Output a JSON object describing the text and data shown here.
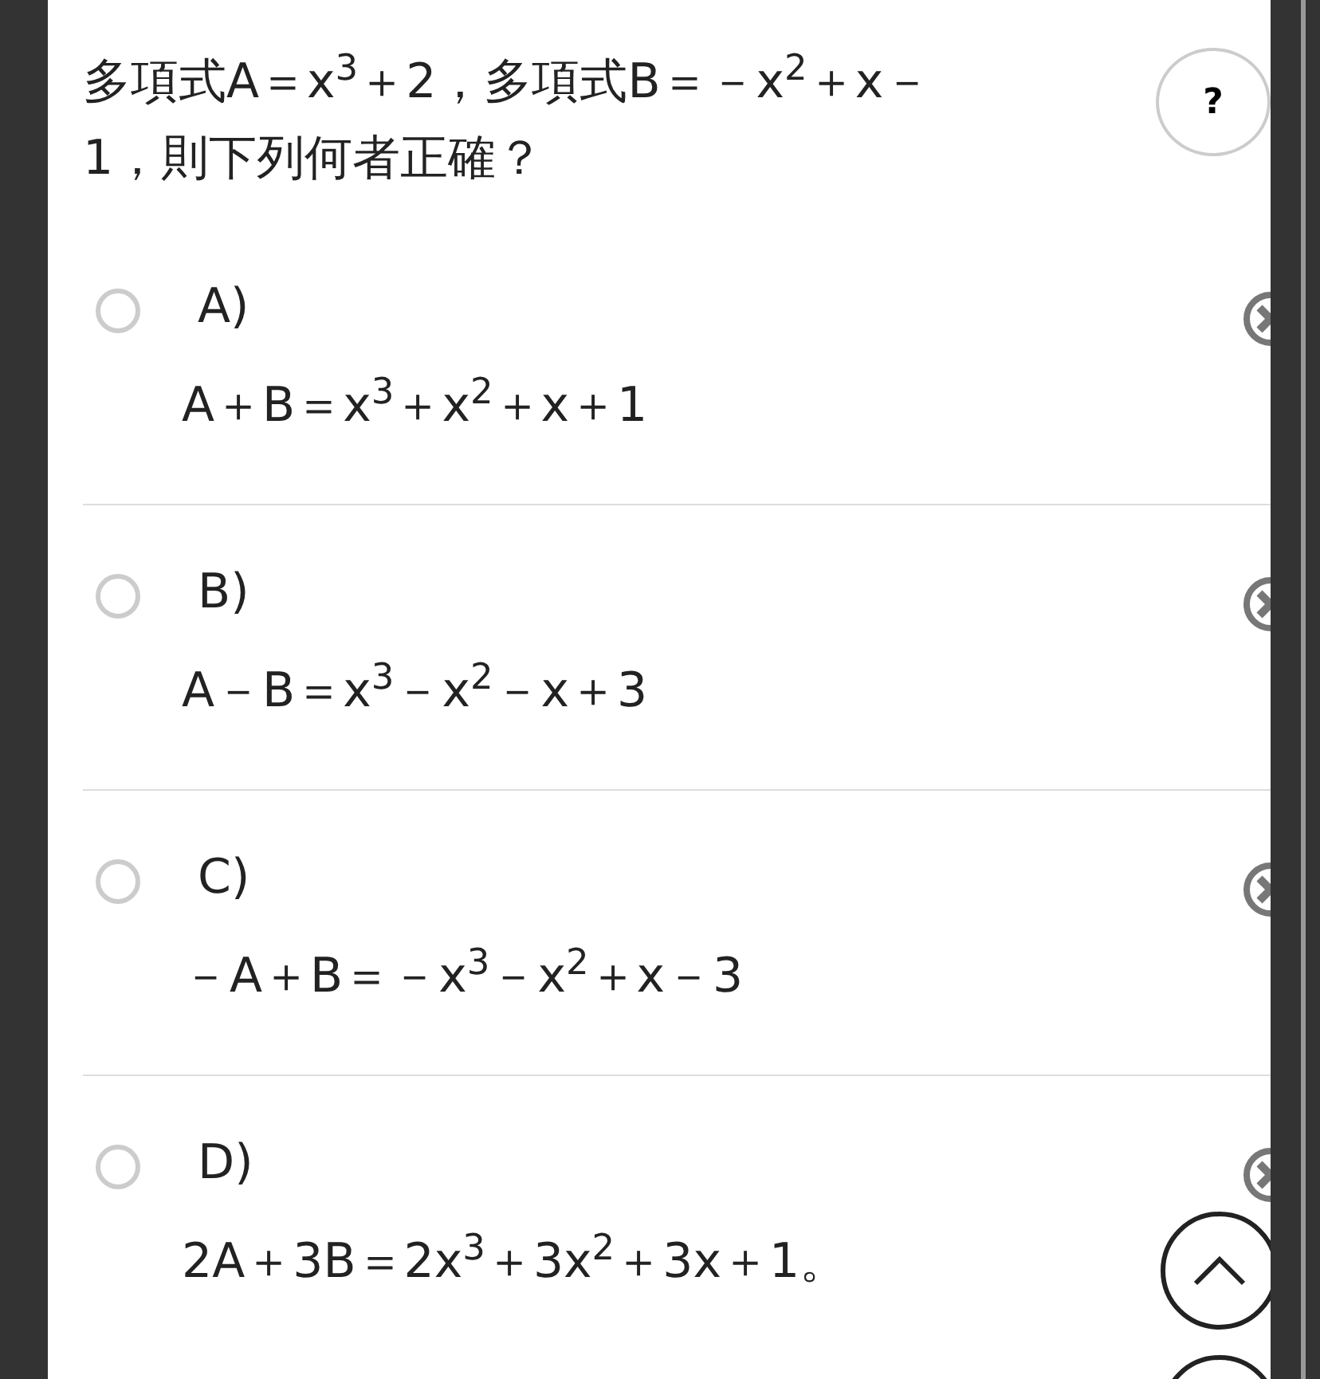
{
  "question": {
    "text": "多項式A＝x$^{3}$＋2，多項式B＝－x$^{2}$＋x－1，則下列何者正確？",
    "help_label": "?"
  },
  "options": [
    {
      "label": "A)",
      "formula": "A＋B＝x$^{3}$＋x$^{2}$＋x＋1",
      "selected": false
    },
    {
      "label": "B)",
      "formula": "A－B＝x$^{3}$－x$^{2}$－x＋3",
      "selected": false
    },
    {
      "label": "C)",
      "formula": "－A＋B＝－x$^{3}$－x$^{2}$＋x－3",
      "selected": false
    },
    {
      "label": "D)",
      "formula": "2A＋3B＝2x$^{3}$＋3x$^{2}$＋3x＋1。",
      "selected": false
    }
  ]
}
